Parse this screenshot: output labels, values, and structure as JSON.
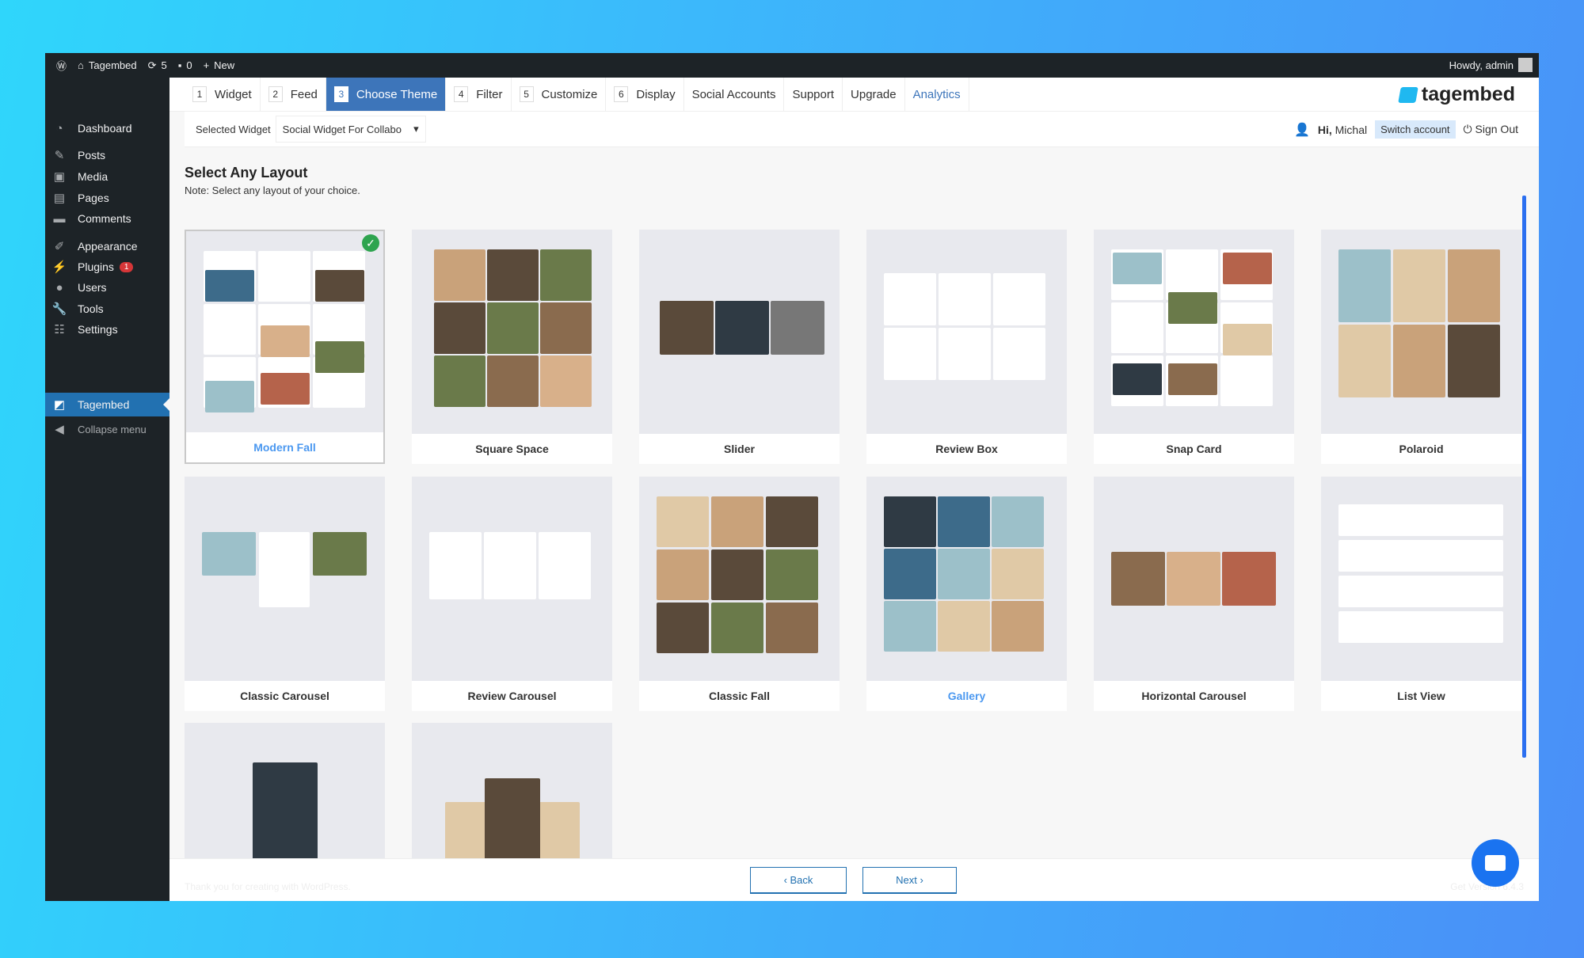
{
  "adminbar": {
    "site": "Tagembed",
    "updates": "5",
    "comments": "0",
    "new": "New",
    "howdy": "Howdy, admin"
  },
  "sidebar": {
    "items": [
      {
        "label": "Dashboard",
        "icon": "dashboard-icon"
      },
      {
        "label": "Posts",
        "icon": "pin-icon"
      },
      {
        "label": "Media",
        "icon": "media-icon"
      },
      {
        "label": "Pages",
        "icon": "pages-icon"
      },
      {
        "label": "Comments",
        "icon": "comment-icon"
      },
      {
        "label": "Appearance",
        "icon": "brush-icon"
      },
      {
        "label": "Plugins",
        "icon": "plugin-icon",
        "badge": "1"
      },
      {
        "label": "Users",
        "icon": "user-icon"
      },
      {
        "label": "Tools",
        "icon": "wrench-icon"
      },
      {
        "label": "Settings",
        "icon": "settings-icon"
      },
      {
        "label": "Tagembed",
        "icon": "tagembed-icon"
      },
      {
        "label": "Collapse menu",
        "icon": "collapse-icon"
      }
    ]
  },
  "tabs": [
    {
      "num": "1",
      "label": "Widget"
    },
    {
      "num": "2",
      "label": "Feed"
    },
    {
      "num": "3",
      "label": "Choose Theme"
    },
    {
      "num": "4",
      "label": "Filter"
    },
    {
      "num": "5",
      "label": "Customize"
    },
    {
      "num": "6",
      "label": "Display"
    },
    {
      "label": "Social Accounts"
    },
    {
      "label": "Support"
    },
    {
      "label": "Upgrade"
    },
    {
      "label": "Analytics"
    }
  ],
  "brand": "tagembed",
  "widget": {
    "label": "Selected Widget",
    "value": "Social Widget For Collabo"
  },
  "user": {
    "hi": "Hi,",
    "name": "Michal",
    "switch": "Switch account",
    "signout": "Sign Out"
  },
  "page": {
    "title": "Select Any Layout",
    "note": "Note: Select any layout of your choice."
  },
  "layouts": [
    "Modern Fall",
    "Square Space",
    "Slider",
    "Review Box",
    "Snap Card",
    "Polaroid",
    "Classic Carousel",
    "Review Carousel",
    "Classic Fall",
    "Gallery",
    "Horizontal Carousel",
    "List View",
    "",
    ""
  ],
  "selected_layout": "Modern Fall",
  "footer": {
    "back": "Back",
    "next": "Next",
    "thanks": "Thank you for creating with WordPress.",
    "version": "Get Version 6.4.3"
  }
}
